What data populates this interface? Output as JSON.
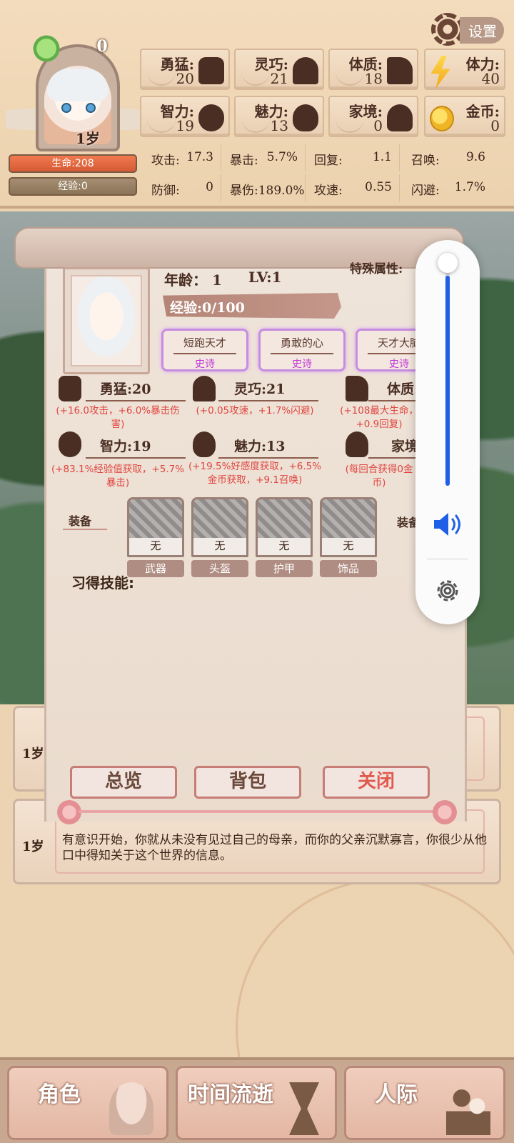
{
  "header": {
    "avatar": {
      "level": "0",
      "age": "1岁"
    },
    "hp_label": "生命:208",
    "xp_label": "经验:0",
    "settings_label": "设置",
    "stats": [
      {
        "label": "勇猛:",
        "value": "20",
        "icon": "fist-icon"
      },
      {
        "label": "灵巧:",
        "value": "21",
        "icon": "cloak-icon"
      },
      {
        "label": "体质:",
        "value": "18",
        "icon": "arm-icon"
      },
      {
        "label": "体力:",
        "value": "40",
        "icon": "lightning-icon"
      },
      {
        "label": "智力:",
        "value": "19",
        "icon": "brain-icon"
      },
      {
        "label": "魅力:",
        "value": "13",
        "icon": "flower-icon"
      },
      {
        "label": "家境:",
        "value": "0",
        "icon": "hand-icon"
      },
      {
        "label": "金币:",
        "value": "0",
        "icon": "coin-icon"
      }
    ],
    "summary": [
      {
        "k": "攻击:",
        "v": "17.3"
      },
      {
        "k": "暴击:",
        "v": "5.7%"
      },
      {
        "k": "回复:",
        "v": "1.1"
      },
      {
        "k": "召唤:",
        "v": "9.6"
      },
      {
        "k": "防御:",
        "v": "0"
      },
      {
        "k": "暴伤:189.0%",
        "v": ""
      },
      {
        "k": "攻速:",
        "v": "0.55"
      },
      {
        "k": "闪避:",
        "v": "1.7%"
      }
    ]
  },
  "panel": {
    "age": "年龄： 1",
    "lv": "LV:1",
    "special": "特殊属性:",
    "xp": "经验:0/100",
    "traits": [
      {
        "name": "短跑天才",
        "rarity": "史诗"
      },
      {
        "name": "勇敢的心",
        "rarity": "史诗"
      },
      {
        "name": "天才大脑",
        "rarity": "史诗"
      }
    ],
    "attributes": [
      {
        "name": "勇猛:20",
        "desc": "(+16.0攻击，+6.0%暴击伤害)"
      },
      {
        "name": "灵巧:21",
        "desc": "(+0.05攻速，+1.7%闪避)"
      },
      {
        "name": "体质:18",
        "desc": "(+108最大生命，+0.9回复)"
      },
      {
        "name": "智力:19",
        "desc": "(+83.1%经验值获取，+5.7%暴击)"
      },
      {
        "name": "魅力:13",
        "desc": "(+19.5%好感度获取，+6.5%金币获取，+9.1召唤)"
      },
      {
        "name": "家境:0",
        "desc": "(每回合获得0金币)"
      }
    ],
    "equip_label": "装备",
    "equip_label_right": "装备",
    "equipment": [
      {
        "slot": "武器",
        "item": "无"
      },
      {
        "slot": "头盔",
        "item": "无"
      },
      {
        "slot": "护甲",
        "item": "无"
      },
      {
        "slot": "饰品",
        "item": "无"
      }
    ],
    "skills_title": "习得技能:",
    "buttons": {
      "overview": "总览",
      "bag": "背包",
      "close": "关闭"
    }
  },
  "log": [
    {
      "age": "1岁",
      "text": ""
    },
    {
      "age": "1岁",
      "text": "有意识开始，你就从未没有见过自己的母亲，而你的父亲沉默寡言，你很少从他口中得知关于这个世界的信息。"
    }
  ],
  "nav": {
    "role": "角色",
    "time": "时间流逝",
    "social": "人际"
  },
  "volume": {
    "level": 0.95
  }
}
